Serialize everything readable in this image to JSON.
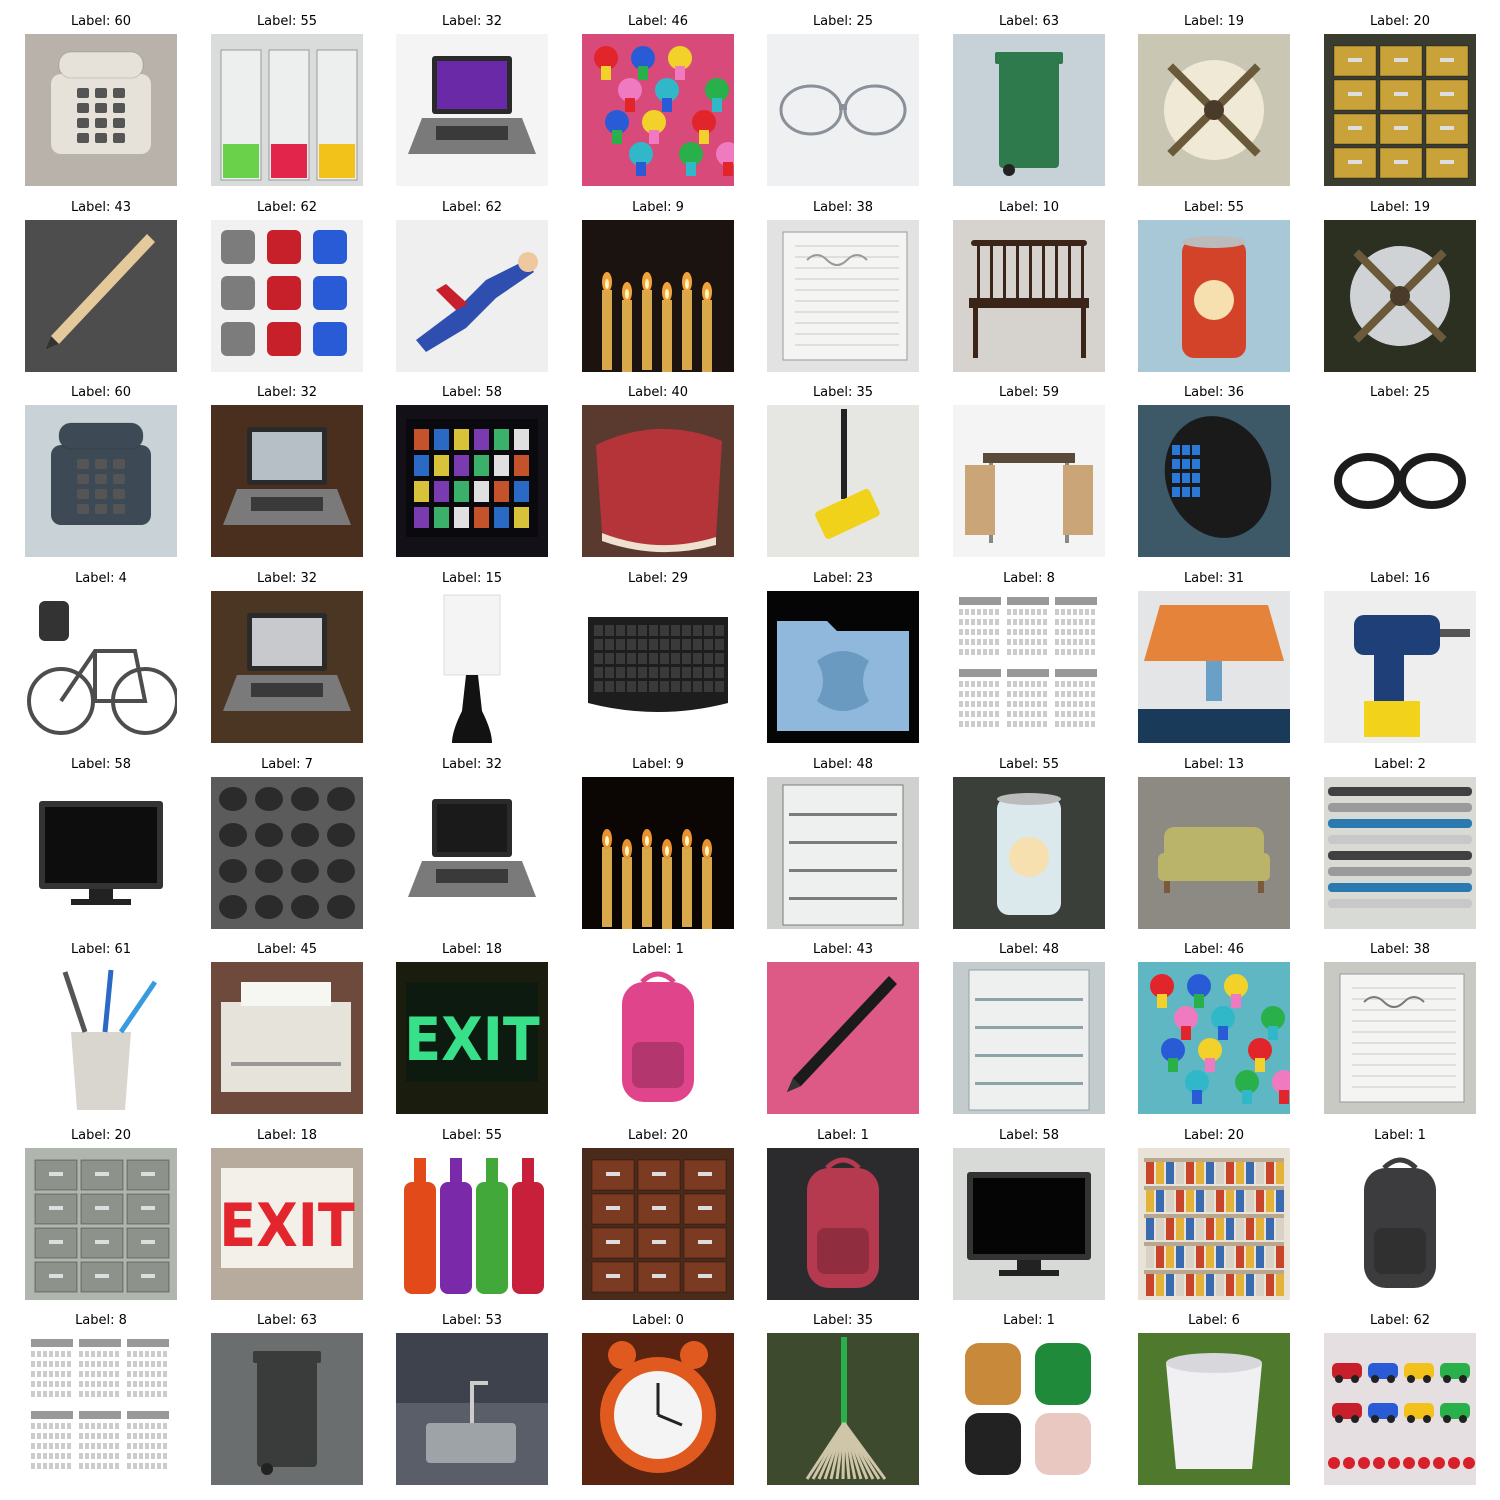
{
  "grid": {
    "label_prefix": "Label: ",
    "images": [
      {
        "label": "60",
        "subject": "beige push-button telephone",
        "bg": "#b8b2aa",
        "fg": "#e6e2da",
        "shape": "phone"
      },
      {
        "label": "55",
        "subject": "glasses of colorful soda drinks",
        "bg": "#d9dcda",
        "fg": "#69d24a",
        "shape": "glasses"
      },
      {
        "label": "32",
        "subject": "open laptop with purple screen",
        "bg": "#f4f4f4",
        "fg": "#6a2aa8",
        "shape": "laptop"
      },
      {
        "label": "46",
        "subject": "colorful push pins",
        "bg": "#d74a7a",
        "fg": "#2a5bd7",
        "shape": "pins"
      },
      {
        "label": "25",
        "subject": "eyeglasses on white keyboard",
        "bg": "#eef0f2",
        "fg": "#8a9098",
        "shape": "eyeglasses"
      },
      {
        "label": "63",
        "subject": "green trash bin on beach",
        "bg": "#c7d2d8",
        "fg": "#2f7a4c",
        "shape": "bin"
      },
      {
        "label": "19",
        "subject": "ceiling fan from below",
        "bg": "#c9c6b3",
        "fg": "#efe9d5",
        "shape": "fan"
      },
      {
        "label": "20",
        "subject": "yellow filing cabinets",
        "bg": "#3a3c30",
        "fg": "#c9a33a",
        "shape": "cabinets"
      },
      {
        "label": "43",
        "subject": "wooden pencil",
        "bg": "#4d4d4d",
        "fg": "#e4c99a",
        "shape": "pencil"
      },
      {
        "label": "62",
        "subject": "assorted toy robots and gadgets",
        "bg": "#f1f1f1",
        "fg": "#7c7c7c",
        "shape": "toys"
      },
      {
        "label": "62",
        "subject": "superman action figure",
        "bg": "#efefef",
        "fg": "#2e4fb0",
        "shape": "figure"
      },
      {
        "label": "9",
        "subject": "lit church candles",
        "bg": "#1a1310",
        "fg": "#f2a23a",
        "shape": "candles"
      },
      {
        "label": "38",
        "subject": "handwritten notebook page",
        "bg": "#e2e2e2",
        "fg": "#9a9a9a",
        "shape": "notebook"
      },
      {
        "label": "10",
        "subject": "wooden windsor bench chair",
        "bg": "#d6d3cf",
        "fg": "#3b2418",
        "shape": "bench"
      },
      {
        "label": "55",
        "subject": "red soda can",
        "bg": "#a8c8d8",
        "fg": "#d2432a",
        "shape": "can"
      },
      {
        "label": "19",
        "subject": "desk fan near monitor",
        "bg": "#2b3020",
        "fg": "#cfd3d6",
        "shape": "deskfan"
      },
      {
        "label": "60",
        "subject": "office IP desk phone",
        "bg": "#c9d2d6",
        "fg": "#3d4a55",
        "shape": "phone"
      },
      {
        "label": "32",
        "subject": "laptop on wooden table",
        "bg": "#4a2f1e",
        "fg": "#b7bfc6",
        "shape": "laptop"
      },
      {
        "label": "58",
        "subject": "TV showing movie thumbnails",
        "bg": "#141018",
        "fg": "#c4522a",
        "shape": "tvgrid"
      },
      {
        "label": "40",
        "subject": "raw beef steak",
        "bg": "#5a3a2e",
        "fg": "#b4343a",
        "shape": "meat"
      },
      {
        "label": "35",
        "subject": "yellow floor mop on tiles",
        "bg": "#e6e6e2",
        "fg": "#f0d21a",
        "shape": "mop"
      },
      {
        "label": "59",
        "subject": "dining table with chairs",
        "bg": "#f4f4f4",
        "fg": "#c9a577",
        "shape": "table"
      },
      {
        "label": "36",
        "subject": "black gaming mouse",
        "bg": "#3d5866",
        "fg": "#1a1a1a",
        "shape": "mouse"
      },
      {
        "label": "25",
        "subject": "thick black glasses",
        "bg": "#ffffff",
        "fg": "#1c1c1c",
        "shape": "eyeglasses"
      },
      {
        "label": "4",
        "subject": "bicycle with child seat",
        "bg": "#ffffff",
        "fg": "#4d4d4d",
        "shape": "bike"
      },
      {
        "label": "32",
        "subject": "laptop and netbook",
        "bg": "#4a3622",
        "fg": "#c7c9cc",
        "shape": "laptop"
      },
      {
        "label": "15",
        "subject": "black table lamp with white shade",
        "bg": "#ffffff",
        "fg": "#121212",
        "shape": "lamp"
      },
      {
        "label": "29",
        "subject": "ergonomic black keyboard",
        "bg": "#ffffff",
        "fg": "#1d1d1d",
        "shape": "keyboard"
      },
      {
        "label": "23",
        "subject": "blue folder icon",
        "bg": "#050505",
        "fg": "#8fb8dc",
        "shape": "folder"
      },
      {
        "label": "8",
        "subject": "printed yearly calendar",
        "bg": "#ffffff",
        "fg": "#888888",
        "shape": "calendar"
      },
      {
        "label": "31",
        "subject": "patterned orange lampshade",
        "bg": "#e3e5e6",
        "fg": "#e5833a",
        "shape": "shade"
      },
      {
        "label": "16",
        "subject": "blue cordless drill",
        "bg": "#eeeeee",
        "fg": "#1e3f78",
        "shape": "drill"
      },
      {
        "label": "58",
        "subject": "flat screen television",
        "bg": "#ffffff",
        "fg": "#0d0d0d",
        "shape": "tv"
      },
      {
        "label": "7",
        "subject": "calculator keypad close-up",
        "bg": "#5b5b5b",
        "fg": "#2b2b2b",
        "shape": "keypad"
      },
      {
        "label": "32",
        "subject": "black laptop",
        "bg": "#ffffff",
        "fg": "#1a1a1a",
        "shape": "laptop"
      },
      {
        "label": "9",
        "subject": "candles burning in dark",
        "bg": "#0b0603",
        "fg": "#e89232",
        "shape": "candles"
      },
      {
        "label": "48",
        "subject": "open refrigerator door",
        "bg": "#cfd1cf",
        "fg": "#7a7c7a",
        "shape": "fridge"
      },
      {
        "label": "55",
        "subject": "glass and soda bottle",
        "bg": "#3a3f3a",
        "fg": "#dbe8ec",
        "shape": "bottle"
      },
      {
        "label": "13",
        "subject": "green miniature sofa",
        "bg": "#8d8a83",
        "fg": "#b9b46a",
        "shape": "sofa"
      },
      {
        "label": "2",
        "subject": "row of pens and markers",
        "bg": "#d8dad6",
        "fg": "#404040",
        "shape": "pens"
      },
      {
        "label": "61",
        "subject": "toothbrushes in cup",
        "bg": "#ffffff",
        "fg": "#d9d6d0",
        "shape": "toothbrush"
      },
      {
        "label": "45",
        "subject": "dot matrix printer",
        "bg": "#6e4a3c",
        "fg": "#e6e3da",
        "shape": "printer"
      },
      {
        "label": "18",
        "subject": "green EXIT sign",
        "bg": "#1a1c0e",
        "fg": "#39e08a",
        "shape": "exit"
      },
      {
        "label": "1",
        "subject": "floral pink backpack",
        "bg": "#ffffff",
        "fg": "#e0448a",
        "shape": "backpack"
      },
      {
        "label": "43",
        "subject": "black pencil on pink surface",
        "bg": "#de5a86",
        "fg": "#1b1b1b",
        "shape": "pencil"
      },
      {
        "label": "48",
        "subject": "empty refrigerator interior",
        "bg": "#c4cbcc",
        "fg": "#8ea3a8",
        "shape": "fridge"
      },
      {
        "label": "46",
        "subject": "yellow and teal push pins",
        "bg": "#5fb7c3",
        "fg": "#f2d22a",
        "shape": "pins"
      },
      {
        "label": "38",
        "subject": "notebook with italian notes",
        "bg": "#c9c9c4",
        "fg": "#7a7a76",
        "shape": "notebook"
      },
      {
        "label": "20",
        "subject": "grey filing cabinets",
        "bg": "#b0b5ae",
        "fg": "#8d938a",
        "shape": "cabinets"
      },
      {
        "label": "18",
        "subject": "red EXIT sign",
        "bg": "#b6ab9c",
        "fg": "#e3252e",
        "shape": "exit"
      },
      {
        "label": "55",
        "subject": "Jolly Rancher soda bottles",
        "bg": "#ffffff",
        "fg": "#42a83a",
        "shape": "bottles"
      },
      {
        "label": "20",
        "subject": "wooden filing cabinet with books",
        "bg": "#4a2a1a",
        "fg": "#7b3a22",
        "shape": "cabinets"
      },
      {
        "label": "1",
        "subject": "open backpack with pockets",
        "bg": "#2b2b2e",
        "fg": "#b5394f",
        "shape": "backpack"
      },
      {
        "label": "58",
        "subject": "vintage television",
        "bg": "#d8dad8",
        "fg": "#050505",
        "shape": "tv"
      },
      {
        "label": "20",
        "subject": "shelves of colored file folders",
        "bg": "#e9e2d6",
        "fg": "#c8452a",
        "shape": "shelves"
      },
      {
        "label": "1",
        "subject": "grey backpack",
        "bg": "#ffffff",
        "fg": "#3c3c3e",
        "shape": "backpack"
      },
      {
        "label": "8",
        "subject": "monthly calendar grid",
        "bg": "#ffffff",
        "fg": "#6a6a6a",
        "shape": "calendar"
      },
      {
        "label": "63",
        "subject": "solar trash compactor",
        "bg": "#6a6e6e",
        "fg": "#3a3c3c",
        "shape": "bin"
      },
      {
        "label": "53",
        "subject": "kitchen sink",
        "bg": "#3e424c",
        "fg": "#9ea3a8",
        "shape": "sink"
      },
      {
        "label": "0",
        "subject": "orange alarm clock",
        "bg": "#5a2410",
        "fg": "#e0591e",
        "shape": "clock"
      },
      {
        "label": "35",
        "subject": "string mop outdoors",
        "bg": "#3e4a2e",
        "fg": "#cfc5a8",
        "shape": "stringmop"
      },
      {
        "label": "1",
        "subject": "studded backpacks",
        "bg": "#ffffff",
        "fg": "#1e8a3a",
        "shape": "backpacks"
      },
      {
        "label": "6",
        "subject": "white plastic bucket",
        "bg": "#4f7a2e",
        "fg": "#f0f0f2",
        "shape": "bucket"
      },
      {
        "label": "62",
        "subject": "toy race cars on table",
        "bg": "#e6dfe2",
        "fg": "#c8202a",
        "shape": "cars"
      }
    ]
  }
}
